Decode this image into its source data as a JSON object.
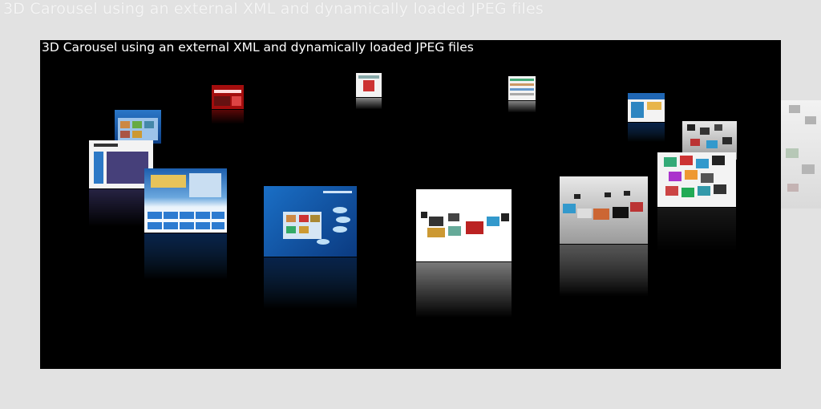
{
  "page": {
    "heading": "3D Carousel using an external XML and dynamically loaded JPEG files"
  },
  "carousel": {
    "title": "3D Carousel using an external XML and dynamically loaded JPEG files",
    "items": [
      {
        "name": "carousel-item-red-page",
        "style": "red-site"
      },
      {
        "name": "carousel-item-small-center-1",
        "style": "white-site"
      },
      {
        "name": "carousel-item-small-center-2",
        "style": "white-site"
      },
      {
        "name": "carousel-item-blue-right",
        "style": "white-site"
      },
      {
        "name": "carousel-item-gallery-small",
        "style": "grey-site"
      },
      {
        "name": "carousel-item-blue-left-top",
        "style": "blue-site"
      },
      {
        "name": "carousel-item-white-left",
        "style": "white-site"
      },
      {
        "name": "carousel-item-gallery-right",
        "style": "white-site"
      },
      {
        "name": "carousel-item-blue-grid",
        "style": "blue-site"
      },
      {
        "name": "carousel-item-flash-gallery",
        "style": "blue-site"
      },
      {
        "name": "carousel-item-white-center",
        "style": "white-site"
      },
      {
        "name": "carousel-item-grey-gallery",
        "style": "grey-site"
      }
    ]
  },
  "colors": {
    "stage_background": "#000000",
    "page_background": "#e2e2e2",
    "title_color": "#ffffff"
  }
}
